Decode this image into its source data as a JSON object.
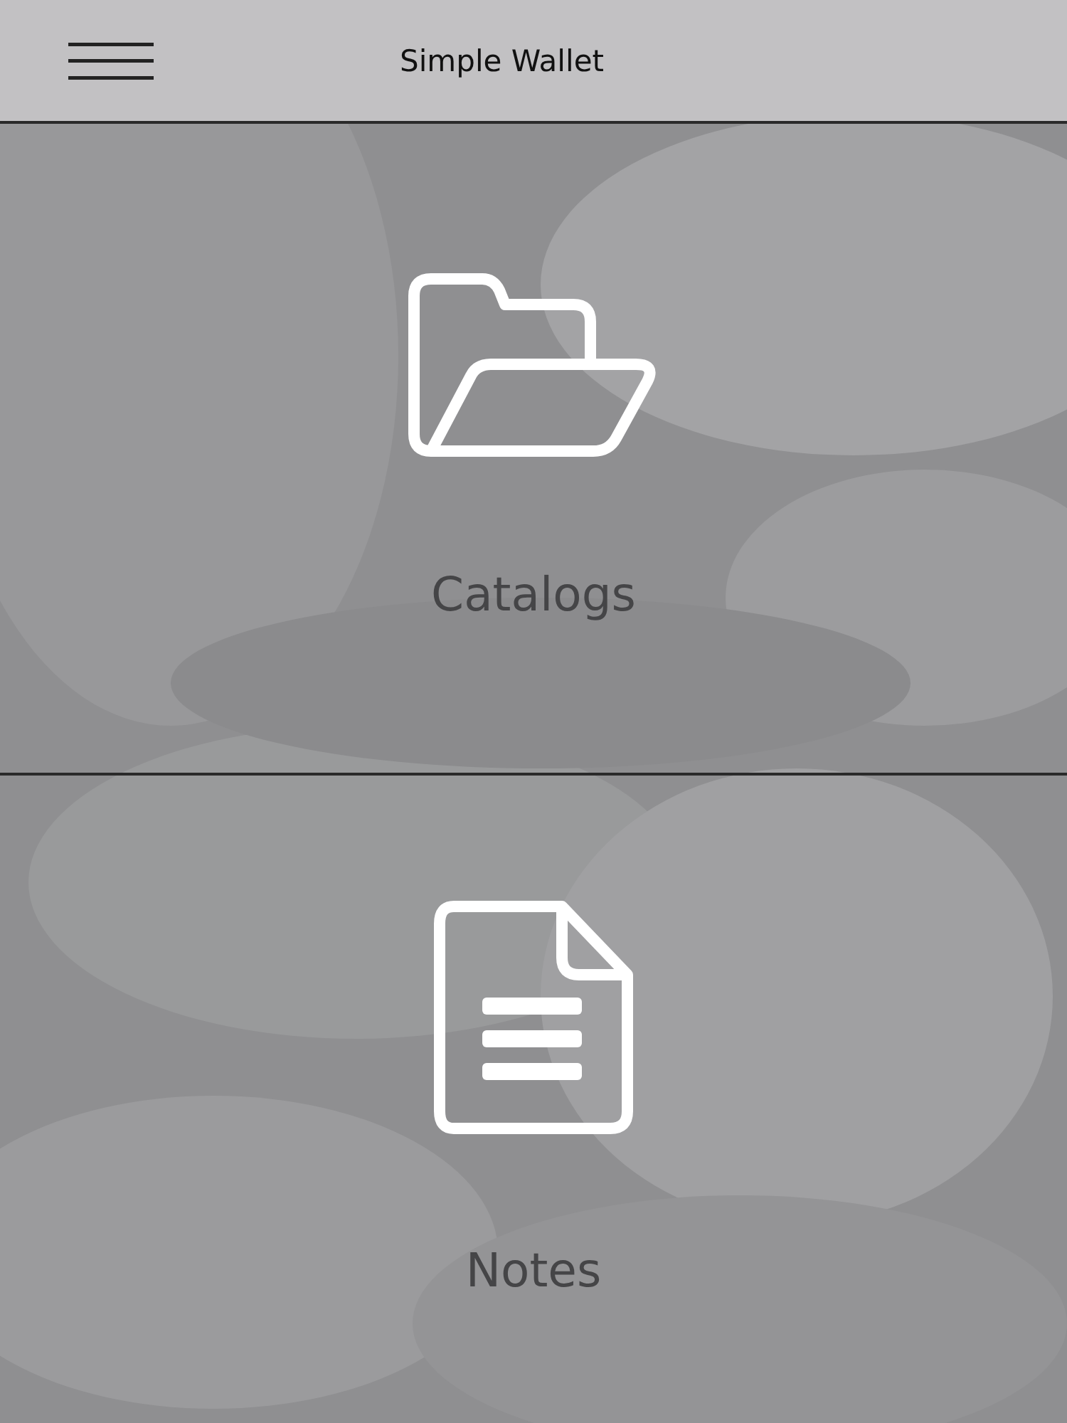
{
  "header": {
    "title": "Simple Wallet"
  },
  "tiles": [
    {
      "label": "Catalogs",
      "kind": "folder"
    },
    {
      "label": "Notes",
      "kind": "document"
    }
  ]
}
